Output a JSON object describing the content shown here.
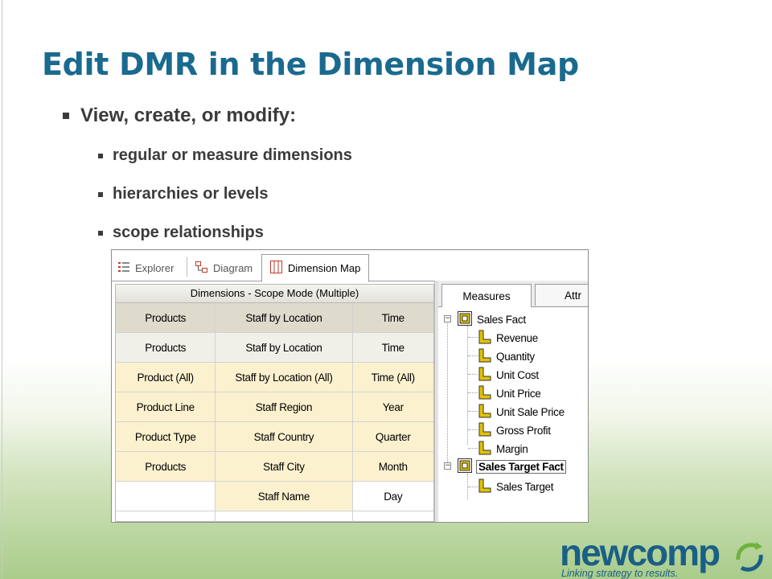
{
  "slide": {
    "title": "Edit DMR in the Dimension Map",
    "bullets": [
      {
        "text": "View, create, or modify:",
        "level": 1
      },
      {
        "text": "regular or measure dimensions",
        "level": 2
      },
      {
        "text": "hierarchies or levels",
        "level": 2
      },
      {
        "text": "scope relationships",
        "level": 2
      }
    ]
  },
  "app": {
    "tabs": {
      "explorer": "Explorer",
      "diagram": "Diagram",
      "dimension_map": "Dimension Map"
    },
    "grid": {
      "header": "Dimensions - Scope Mode (Multiple)",
      "rows": [
        [
          "Products",
          "Staff by Location",
          "Time"
        ],
        [
          "Products",
          "Staff by Location",
          "Time"
        ],
        [
          "Product (All)",
          "Staff by Location (All)",
          "Time (All)"
        ],
        [
          "Product Line",
          "Staff Region",
          "Year"
        ],
        [
          "Product Type",
          "Staff Country",
          "Quarter"
        ],
        [
          "Products",
          "Staff City",
          "Month"
        ],
        [
          "",
          "Staff Name",
          "Day"
        ]
      ]
    },
    "tree_tabs": {
      "measures": "Measures",
      "attr": "Attr"
    },
    "tree": {
      "sales_fact": "Sales Fact",
      "sales_fact_measures": [
        "Revenue",
        "Quantity",
        "Unit Cost",
        "Unit Price",
        "Unit Sale Price",
        "Gross Profit",
        "Margin"
      ],
      "sales_target_fact": "Sales Target Fact",
      "sales_target_measures": [
        "Sales Target"
      ]
    },
    "colors": {
      "title": "#1a6a8f",
      "level_cell": "#fcf1cf",
      "header_cell": "#dedbcd",
      "measure_icon": "#e3c200"
    }
  },
  "logo": {
    "wordmark": "newcomp",
    "tagline": "Linking strategy to results."
  }
}
